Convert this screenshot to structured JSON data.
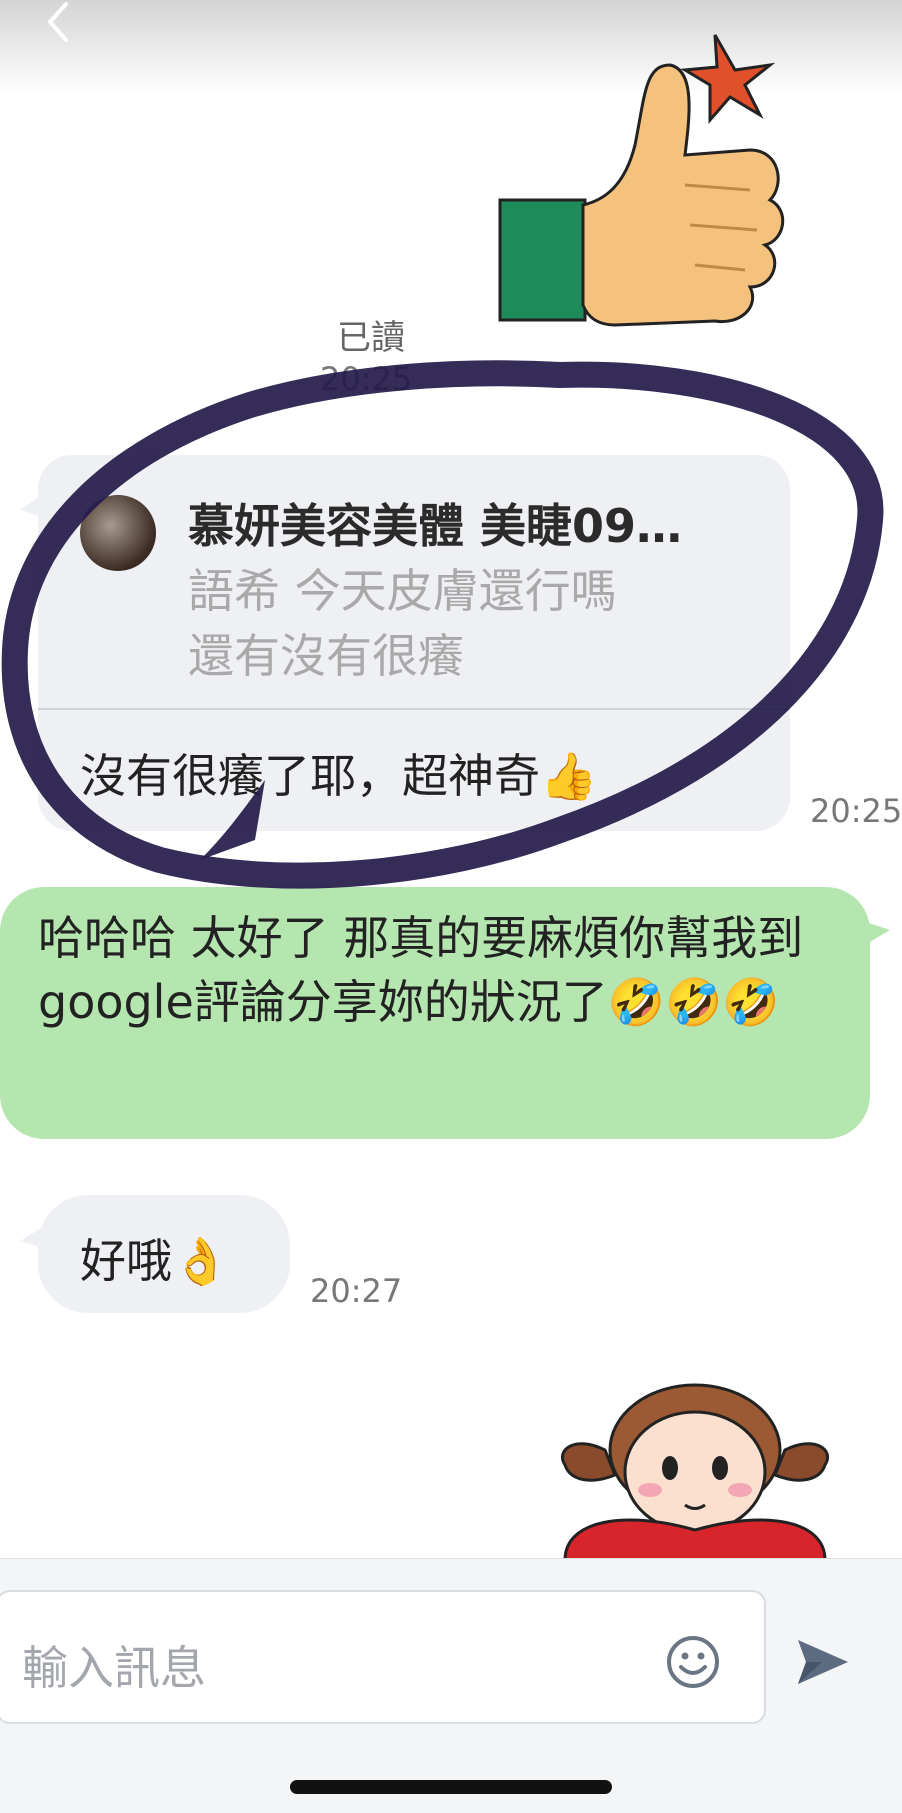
{
  "status": {
    "read_label": "已讀",
    "read_time": "20:25"
  },
  "quoted_reply": {
    "quote_name": "慕妍美容美體 美睫09…",
    "quote_lines": [
      "語希 今天皮膚還行嗎",
      "還有沒有很癢"
    ],
    "reply_text": "沒有很癢了耶，超神奇👍",
    "time": "20:25"
  },
  "outgoing": {
    "text": "哈哈哈 太好了 那真的要麻煩你幫我到google評論分享妳的狀況了🤣🤣🤣"
  },
  "incoming_short": {
    "text": "好哦👌",
    "time": "20:27"
  },
  "input": {
    "placeholder": "輸入訊息"
  },
  "icons": {
    "back": "chevron-left-icon",
    "emoji": "smiley-icon",
    "send": "send-icon"
  },
  "colors": {
    "incoming_bubble": "#eef0f3",
    "outgoing_bubble": "#b5e6b0",
    "circle_mark": "#241a4a"
  }
}
